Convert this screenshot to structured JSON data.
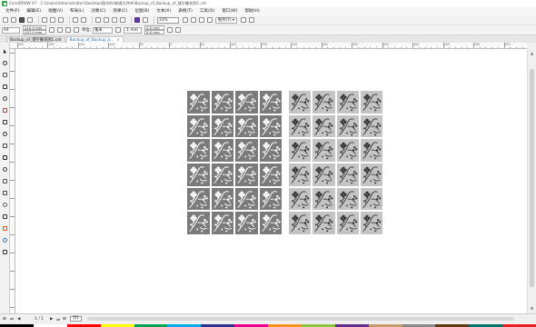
{
  "window": {
    "title": "CorelDRAW X7 - C:\\Users\\Administrator\\Desktop\\图创作\\新建文件夹\\Backup_of_Backup_of_镂空雕花图1.cdr"
  },
  "menu": [
    "文件(F)",
    "编辑(E)",
    "视图(V)",
    "布局(L)",
    "对象(C)",
    "效果(C)",
    "位图(B)",
    "文本(X)",
    "表格(T)",
    "工具(O)",
    "窗口(W)",
    "帮助(H)"
  ],
  "toolbar1": {
    "zoom": "31%",
    "snap_label": "贴齐(T) ▾"
  },
  "toolbar2": {
    "page_size": "A4",
    "width": "210.0 mm",
    "height": "297.0 mm",
    "units_label": "单位:",
    "units_value": "毫米",
    "nudge": ".1 mm",
    "dup_x": "5.0 mm",
    "dup_y": "5.0 mm"
  },
  "tabs": [
    {
      "label": "Backup_of_镂空雕花图1.cdr",
      "active": false
    },
    {
      "label": "Backup_of_Backup_o...",
      "active": true
    }
  ],
  "ruler_labels": [
    "250",
    "200",
    "150",
    "100",
    "50",
    "0",
    "50",
    "100",
    "150",
    "200",
    "250",
    "300",
    "350",
    "400",
    "450",
    "500",
    "550"
  ],
  "status": {
    "page_counter": "1 / 1",
    "page_tab": "页1"
  },
  "palette_colors": [
    "#000000",
    "#ffffff",
    "#ff0000",
    "#ffff00",
    "#00a651",
    "#00aeef",
    "#2e3192",
    "#ec008c",
    "#f7941d",
    "#8dc63f",
    "#662d91",
    "#c69c6d",
    "#898989",
    "#603913",
    "#00746b",
    "#ed1c24"
  ],
  "artwork": {
    "dark_fill": "#7b7b7b",
    "light_fill": "#c4c4c4",
    "motif_dark": "#ffffff",
    "motif_light": "#3a3a3a",
    "rows": 6,
    "cols": 4
  }
}
